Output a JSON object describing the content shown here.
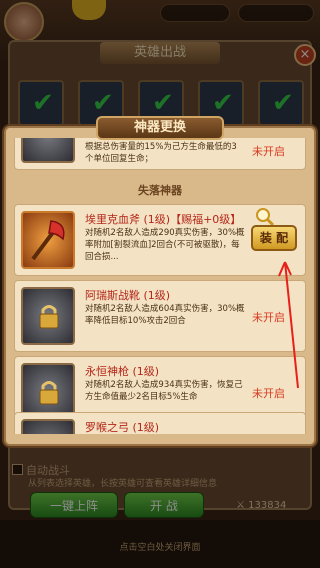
{
  "background": {
    "hero_panel_title": "英雄出战",
    "auto_battle_label": "自动战斗",
    "hint_text": "从列表选择英雄，长按英雄可查看英雄详细信息",
    "one_click_button": "一键上阵",
    "start_button": "开 战",
    "power_value": "133834",
    "close_hint": "点击空白处关闭界面"
  },
  "modal": {
    "title": "神器更换",
    "section_lost": "失落神器",
    "top_card": {
      "desc": "根据总伤害量的15%为己方生命最低的3个单位回复生命；",
      "status": "未开启"
    },
    "items": [
      {
        "name": "埃里克血斧 (1级)【赐福+0级】",
        "desc": "对随机2名敌人造成290真实伤害，30%概率附加[割裂流血]2回合(不可被驱散)，每回合损...",
        "action": "装 配"
      },
      {
        "name": "阿瑞斯战靴 (1级)",
        "desc": "对随机2名敌人造成604真实伤害，30%概率降低目标10%攻击2回合",
        "status": "未开启"
      },
      {
        "name": "永恒神枪 (1级)",
        "desc": "对随机2名敌人造成934真实伤害，恢复己方生命值最少2名目标5%生命",
        "status": "未开启"
      },
      {
        "name": "罗喉之弓 (1级)"
      }
    ]
  },
  "colors": {
    "accent_red": "#d83a20",
    "button_gold": "#f7d774",
    "panel_tan": "#d9b98a"
  }
}
